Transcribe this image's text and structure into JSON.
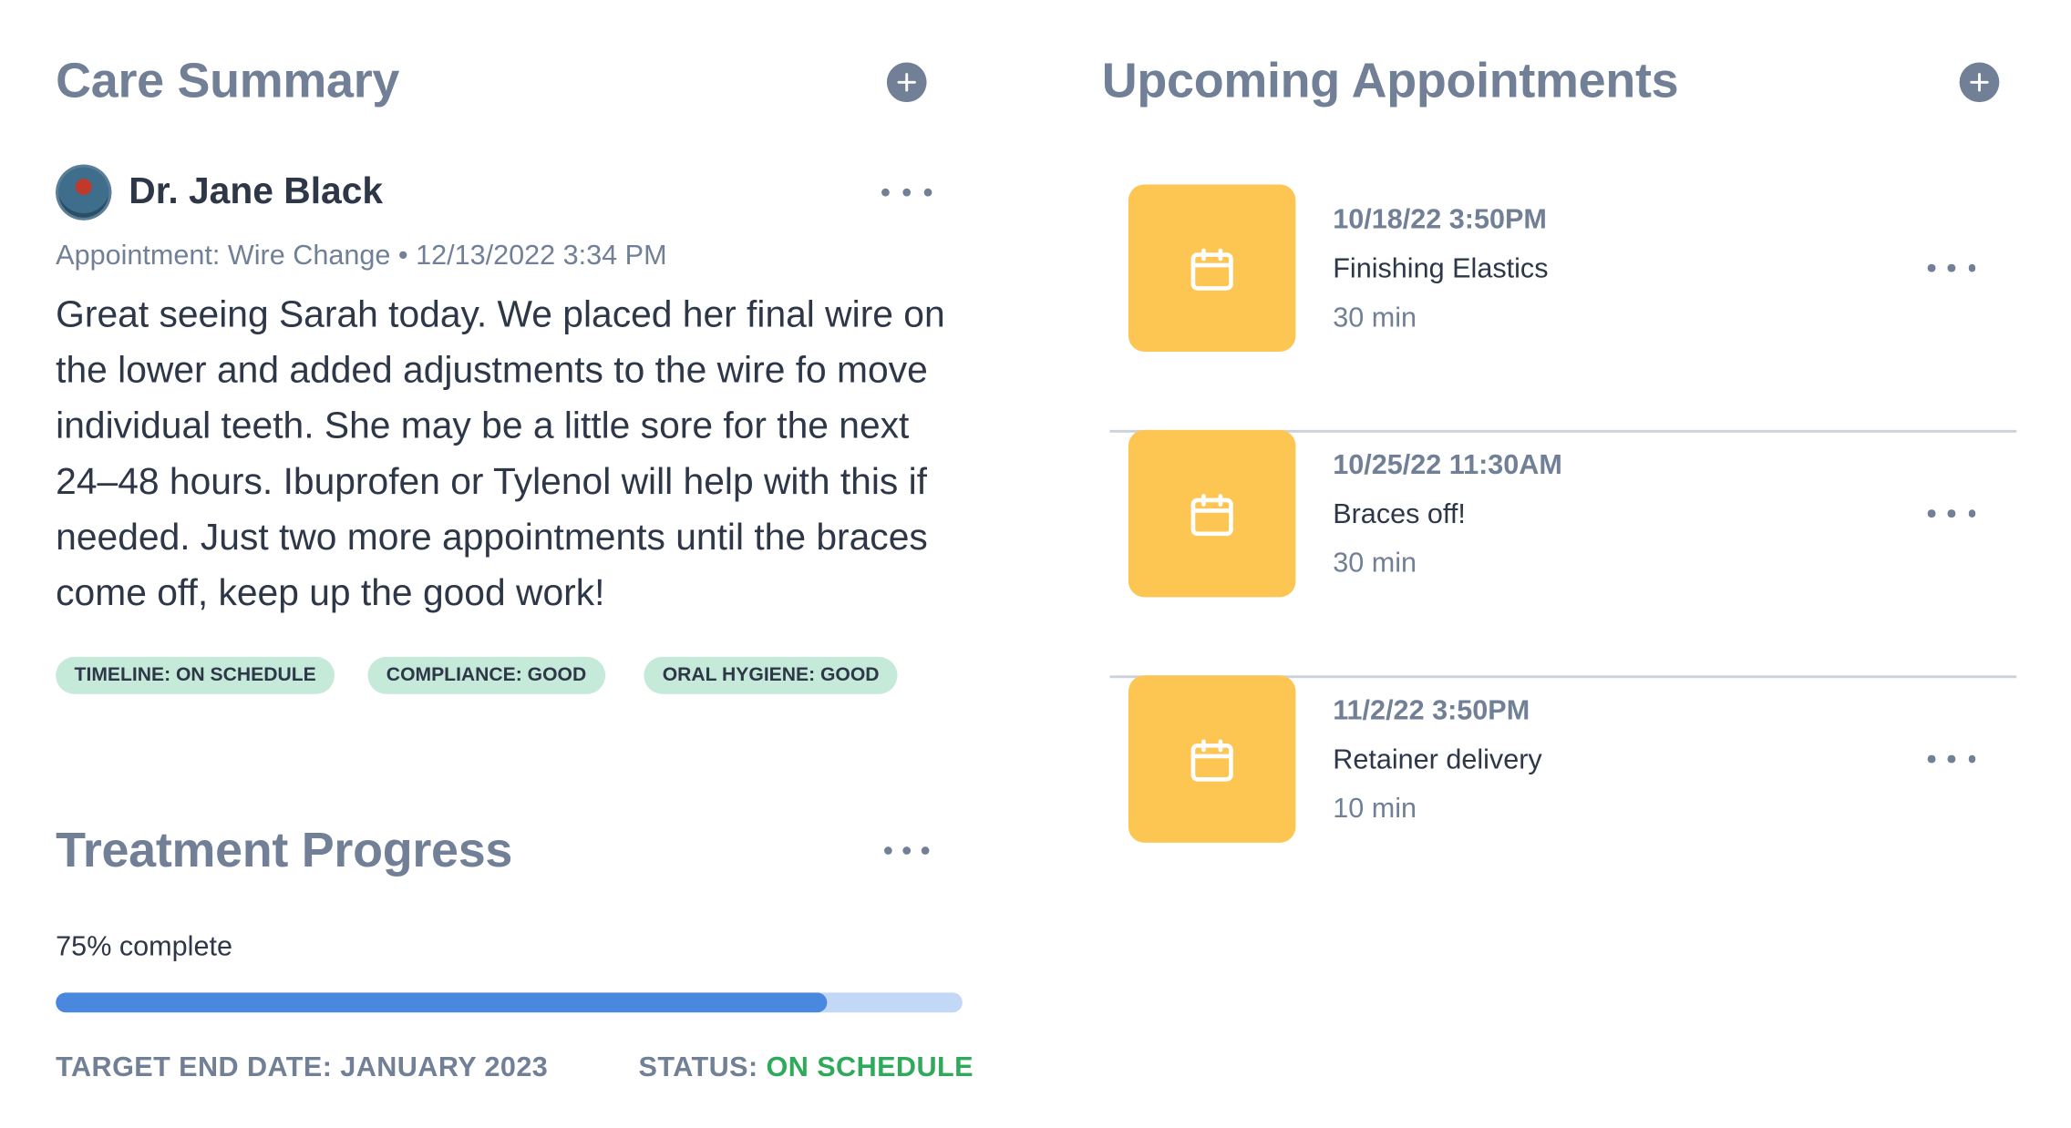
{
  "care_summary": {
    "title": "Care Summary",
    "doctor_name": "Dr. Jane Black",
    "appointment_meta": "Appointment: Wire Change • 12/13/2022 3:34 PM",
    "note": "Great seeing Sarah today. We placed her final wire on the lower and added adjustments to the wire fo move individual teeth. She may be a little sore for the next 24–48 hours. Ibuprofen or Tylenol will help with this if needed. Just two more appointments until the braces come off, keep up the good work!",
    "tags": [
      "TIMELINE: ON SCHEDULE",
      "COMPLIANCE: GOOD",
      "ORAL HYGIENE: GOOD"
    ],
    "add_icon": "plus-circle-icon",
    "more_icon": "ellipsis-icon"
  },
  "treatment_progress": {
    "title": "Treatment Progress",
    "label": "75% complete",
    "percent": 85,
    "target_end_date": "TARGET END DATE: JANUARY 2023",
    "status_label": "STATUS:",
    "status_value": "ON SCHEDULE"
  },
  "upcoming_appointments": {
    "title": "Upcoming Appointments",
    "items": [
      {
        "datetime": "10/18/22 3:50PM",
        "title": "Finishing Elastics",
        "duration": "30 min"
      },
      {
        "datetime": "10/25/22 11:30AM",
        "title": "Braces off!",
        "duration": "30 min"
      },
      {
        "datetime": "11/2/22 3:50PM",
        "title": "Retainer delivery",
        "duration": "10 min"
      }
    ],
    "icon": "calendar-icon"
  },
  "colors": {
    "heading": "#718096",
    "text": "#2d3748",
    "tag_bg": "#c6ead9",
    "progress_fill": "#4a87de",
    "progress_track": "#c3d8f6",
    "status_green": "#2eaa5a",
    "calendar_tile": "#fdc652"
  }
}
